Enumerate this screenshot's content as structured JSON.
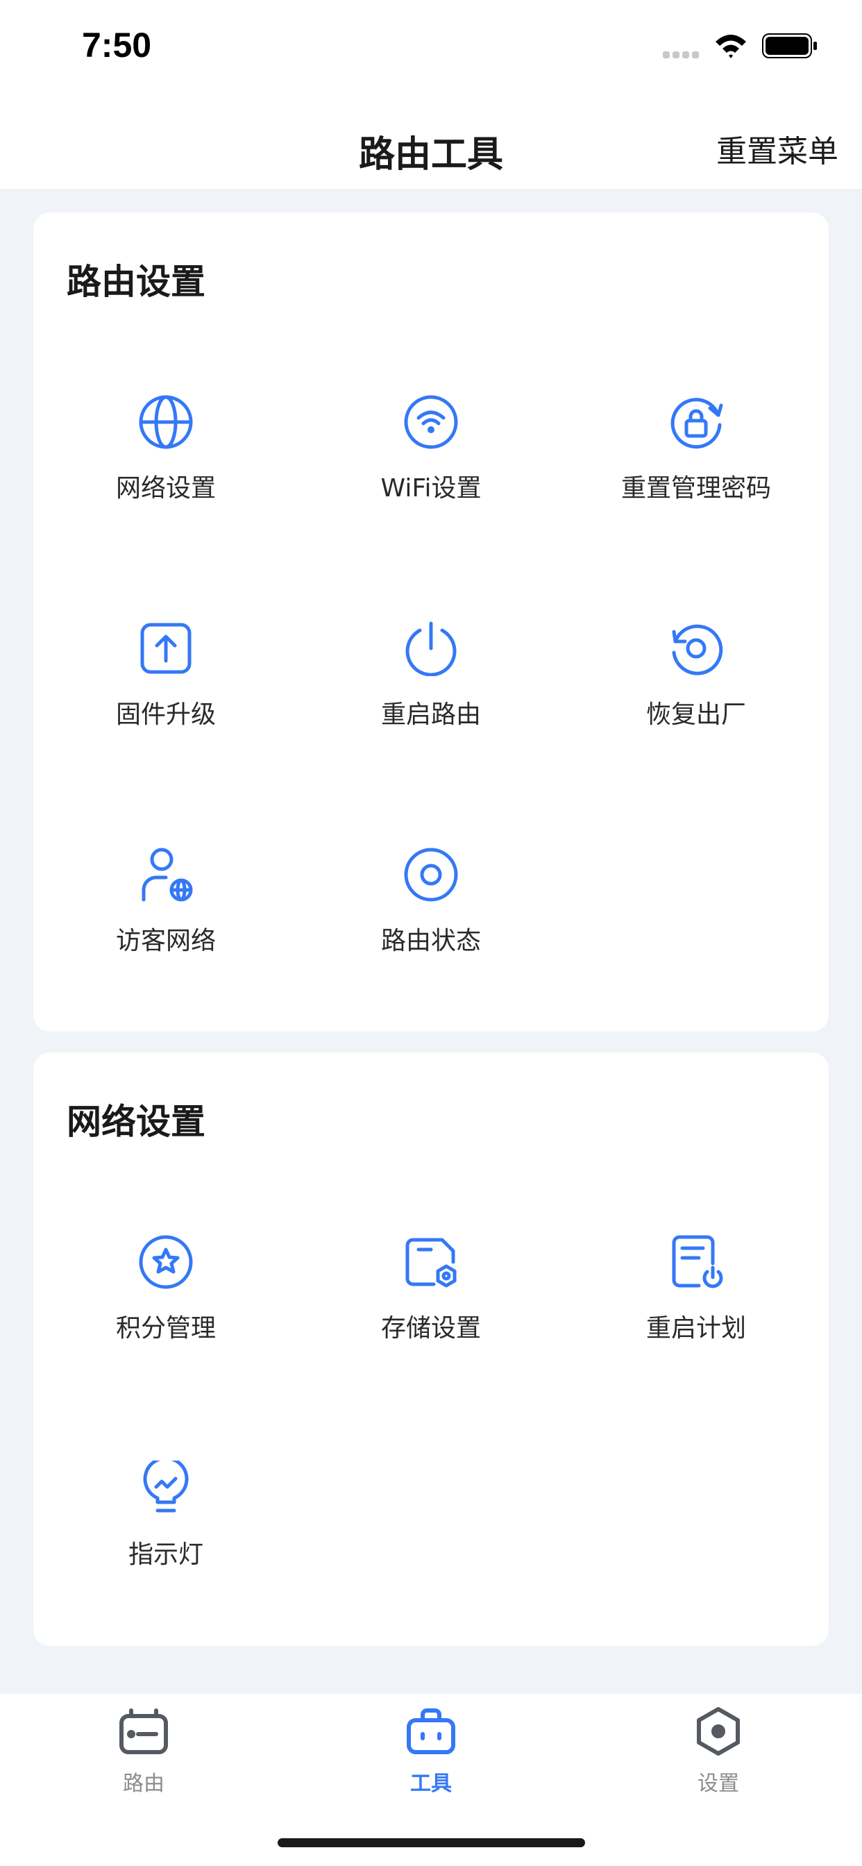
{
  "status_bar": {
    "time": "7:50"
  },
  "nav": {
    "title": "路由工具",
    "action": "重置菜单"
  },
  "sections": [
    {
      "title": "路由设置",
      "items": [
        {
          "label": "网络设置",
          "icon": "globe-icon"
        },
        {
          "label": "WiFi设置",
          "icon": "wifi-icon"
        },
        {
          "label": "重置管理密码",
          "icon": "lock-reset-icon"
        },
        {
          "label": "固件升级",
          "icon": "upload-icon"
        },
        {
          "label": "重启路由",
          "icon": "power-icon"
        },
        {
          "label": "恢复出厂",
          "icon": "restore-icon"
        },
        {
          "label": "访客网络",
          "icon": "guest-user-icon"
        },
        {
          "label": "路由状态",
          "icon": "status-ring-icon"
        }
      ]
    },
    {
      "title": "网络设置",
      "items": [
        {
          "label": "积分管理",
          "icon": "star-badge-icon"
        },
        {
          "label": "存储设置",
          "icon": "storage-icon"
        },
        {
          "label": "重启计划",
          "icon": "schedule-icon"
        },
        {
          "label": "指示灯",
          "icon": "bulb-icon"
        }
      ]
    }
  ],
  "tabs": [
    {
      "label": "路由",
      "icon": "router-icon",
      "active": false
    },
    {
      "label": "工具",
      "icon": "toolbox-icon",
      "active": true
    },
    {
      "label": "设置",
      "icon": "hex-settings-icon",
      "active": false
    }
  ],
  "colors": {
    "accent": "#3478f6",
    "inactive": "#555a61",
    "background": "#f0f3f7"
  }
}
